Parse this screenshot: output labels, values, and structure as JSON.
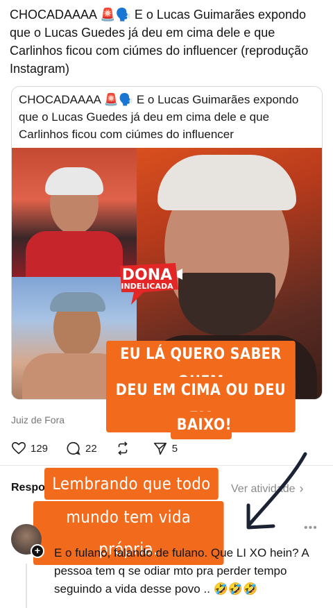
{
  "post": {
    "text": "CHOCADAAAA 🚨🗣️ E o Lucas Guimarães expondo que o Lucas Guedes já deu em cima dele e que Carlinhos ficou com ciúmes do influencer (reprodução Instagram)"
  },
  "card": {
    "text": "CHOCADAAAA 🚨🗣️ E o Lucas Guimarães expondo que o Lucas Guedes já deu em cima dele e que Carlinhos ficou com ciúmes do influencer",
    "logo_line1": "DONA",
    "logo_line2": "INDELICADA"
  },
  "location": "Juiz de Fora",
  "actions": {
    "likes": "129",
    "comments": "22",
    "reposts": "",
    "shares": "5"
  },
  "replies": {
    "label": "Respo",
    "view_activity": "Ver atividade",
    "comment_text": "E o fulano, falando de fulano. Que LI XO hein? A pessoa tem q se odiar mto pra perder tempo seguindo a vida desse povo .. 🤣🤣🤣"
  },
  "overlays": {
    "caption1_line1": "EU LÁ QUERO SABER QUEM",
    "caption1_line2": "DEU EM CIMA OU DEU EM",
    "caption1_line3": "BAIXO!",
    "caption2_line1": "Lembrando que todo",
    "caption2_line2": "mundo tem vida própria."
  },
  "colors": {
    "overlay_orange": "#f26b1d",
    "divider": "#e6e6e6"
  },
  "icons": [
    "heart-icon",
    "comment-icon",
    "repost-icon",
    "share-icon",
    "chevron-right-icon",
    "more-icon",
    "plus-icon",
    "arrow-icon"
  ]
}
